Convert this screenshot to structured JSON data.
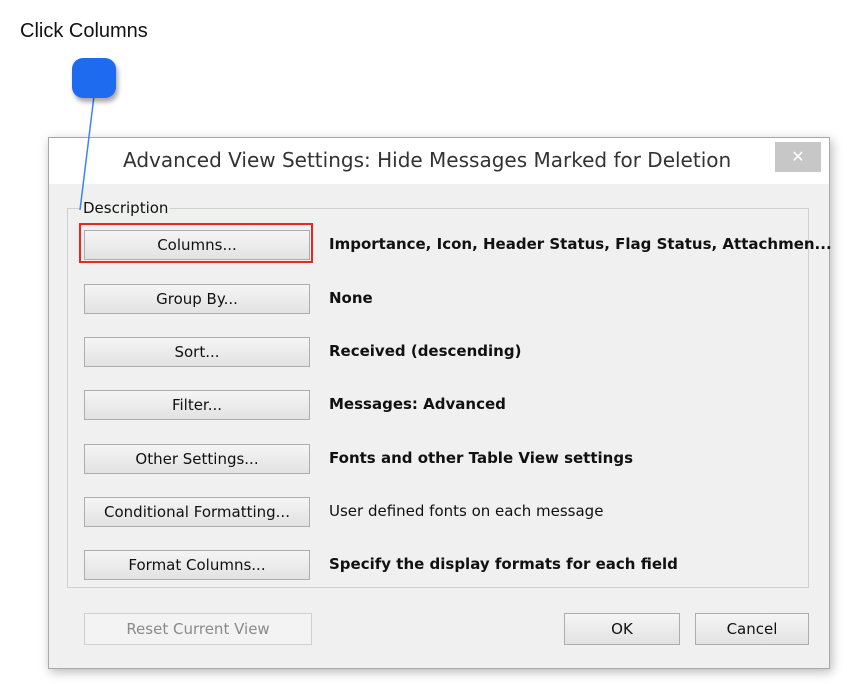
{
  "annotation": {
    "text": "Click Columns"
  },
  "dialog": {
    "title": "Advanced View Settings: Hide Messages Marked for Deletion",
    "close_glyph": "✕",
    "group_label": "Description",
    "rows": [
      {
        "button": "Columns...",
        "description": "Importance, Icon, Header Status, Flag Status, Attachmen...",
        "bold": true
      },
      {
        "button": "Group By...",
        "description": "None",
        "bold": true
      },
      {
        "button": "Sort...",
        "description": "Received (descending)",
        "bold": true
      },
      {
        "button": "Filter...",
        "description": "Messages: Advanced",
        "bold": true
      },
      {
        "button": "Other Settings...",
        "description": "Fonts and other Table View settings",
        "bold": true
      },
      {
        "button": "Conditional Formatting...",
        "description": "User defined fonts on each message",
        "bold": false
      },
      {
        "button": "Format Columns...",
        "description": "Specify the display formats for each field",
        "bold": true
      }
    ],
    "footer": {
      "reset": "Reset Current View",
      "ok": "OK",
      "cancel": "Cancel"
    }
  },
  "colors": {
    "highlight": "#e8281e",
    "callout_dot": "#1f6bf0",
    "callout_line": "#3a86f2"
  }
}
